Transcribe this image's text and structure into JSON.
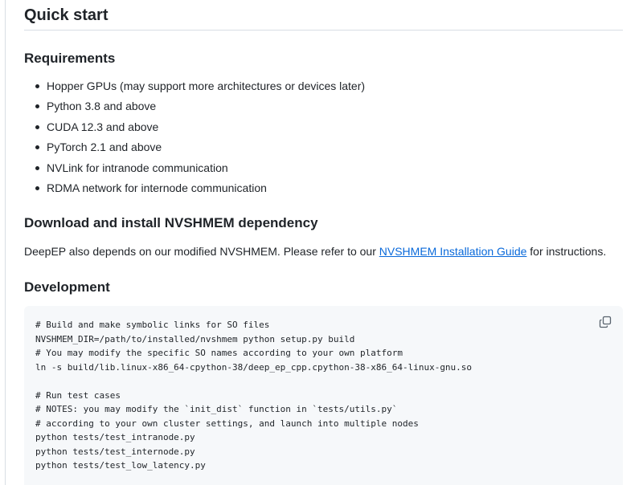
{
  "headings": {
    "quick_start": "Quick start",
    "requirements": "Requirements",
    "download": "Download and install NVSHMEM dependency",
    "development": "Development"
  },
  "requirements": [
    "Hopper GPUs (may support more architectures or devices later)",
    "Python 3.8 and above",
    "CUDA 12.3 and above",
    "PyTorch 2.1 and above",
    "NVLink for intranode communication",
    "RDMA network for internode communication"
  ],
  "download": {
    "text_before": "DeepEP also depends on our modified NVSHMEM. Please refer to our ",
    "link_text": "NVSHMEM Installation Guide",
    "text_after": " for instructions."
  },
  "code": {
    "lines": [
      "# Build and make symbolic links for SO files",
      "NVSHMEM_DIR=/path/to/installed/nvshmem python setup.py build",
      "# You may modify the specific SO names according to your own platform",
      "ln -s build/lib.linux-x86_64-cpython-38/deep_ep_cpp.cpython-38-x86_64-linux-gnu.so",
      "",
      "# Run test cases",
      "# NOTES: you may modify the `init_dist` function in `tests/utils.py`",
      "# according to your own cluster settings, and launch into multiple nodes",
      "python tests/test_intranode.py",
      "python tests/test_internode.py",
      "python tests/test_low_latency.py"
    ],
    "copy_icon": "copy-icon"
  },
  "colors": {
    "link": "#0969da",
    "text": "#1f2328",
    "code_bg": "#f6f8fa",
    "rule": "#d8dee4",
    "comment": "#59636e"
  }
}
